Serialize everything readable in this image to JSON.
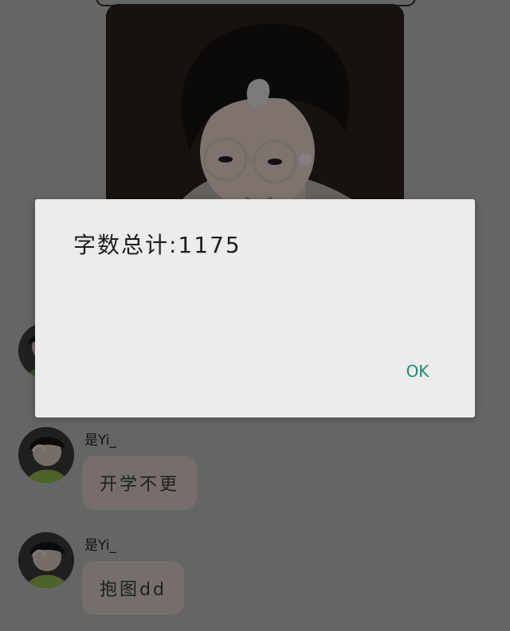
{
  "dialog": {
    "message": "字数总计:1175",
    "ok_label": "OK"
  },
  "messages": [
    {
      "sender": "是Yi_",
      "text": "开学不更"
    },
    {
      "sender": "是Yi_",
      "text": "抱图dd"
    }
  ],
  "colors": {
    "ok_text": "#1f8a7b",
    "bubble_bg": "#d7c9c5",
    "dialog_bg": "#ececec"
  },
  "icons": {
    "photo": "portrait-photo",
    "avatar": "user-avatar"
  }
}
